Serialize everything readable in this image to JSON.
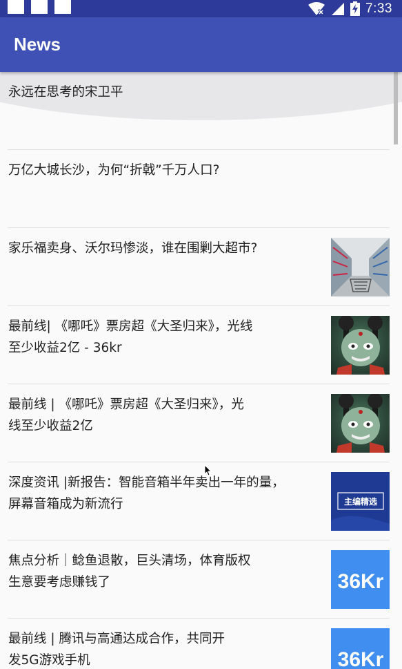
{
  "status_bar": {
    "time": "7:33",
    "icons": [
      "wifi-off-icon",
      "signal-icon",
      "battery-charging-icon"
    ]
  },
  "app_bar": {
    "title": "News"
  },
  "news": [
    {
      "title": "永远在思考的宋卫平",
      "thumbnail": ""
    },
    {
      "title": "万亿大城长沙，为何“折戟”千万人口?",
      "thumbnail": ""
    },
    {
      "title": "家乐福卖身、沃尔玛惨淡，谁在围剿大超市?",
      "thumbnail": "supermarket-aisle-photo"
    },
    {
      "title": "最前线| 《哪吒》票房超《大圣归来》，光线\n至少收益2亿 - 36kr",
      "thumbnail": "nezha-photo"
    },
    {
      "title": "最前线 | 《哪吒》票房超《大圣归来》，光\n线至少收益2亿",
      "thumbnail": "nezha-photo"
    },
    {
      "title": "深度资讯 |新报告：智能音箱半年卖出一年的量，\n屏幕音箱成为新流行",
      "thumbnail": "editor-pick-badge",
      "thumbnail_text": "主编精选"
    },
    {
      "title": "焦点分析｜鲶鱼退散，巨头清场，体育版权\n生意要考虑赚钱了",
      "thumbnail": "36kr-logo",
      "thumbnail_text": "36Kr"
    },
    {
      "title": "最前线 | 腾讯与高通达成合作，共同开\n发5G游戏手机",
      "thumbnail": "36kr-logo",
      "thumbnail_text": "36Kr"
    }
  ],
  "colors": {
    "status_bar": "#2d3a99",
    "app_bar": "#3f51b5",
    "background": "#fafafa",
    "kr_blue": "#3f8ef0"
  }
}
